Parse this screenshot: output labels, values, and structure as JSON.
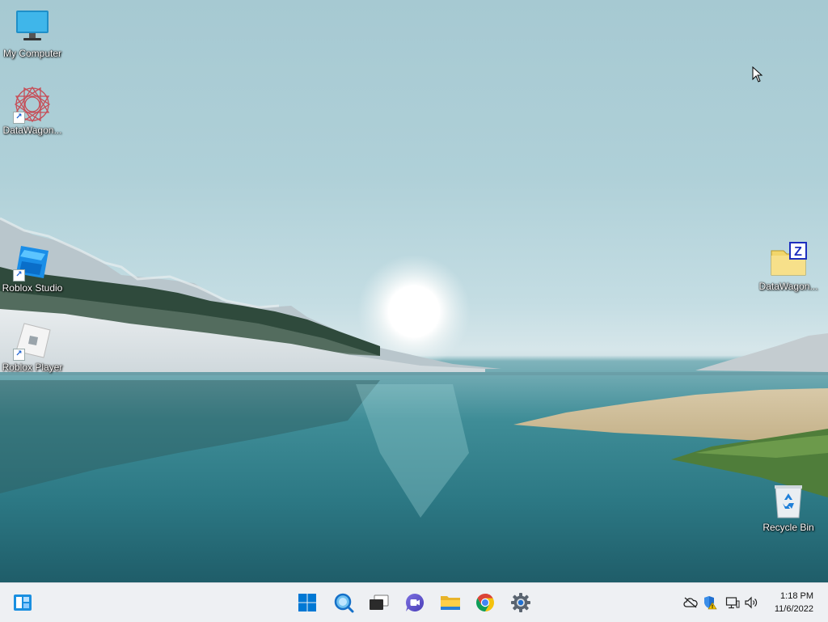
{
  "desktop": {
    "icons": [
      {
        "label": "My Computer",
        "icon": "computer-monitor-icon",
        "shortcut": false
      },
      {
        "label": "DataWagon...",
        "icon": "datawagon-spirograph-icon",
        "shortcut": true
      },
      {
        "label": "Roblox Studio",
        "icon": "roblox-studio-icon",
        "shortcut": true
      },
      {
        "label": "Roblox Player",
        "icon": "roblox-player-icon",
        "shortcut": true
      },
      {
        "label": "DataWagon...",
        "icon": "zip-folder-icon",
        "shortcut": false
      },
      {
        "label": "Recycle Bin",
        "icon": "recycle-bin-icon",
        "shortcut": false
      }
    ]
  },
  "taskbar": {
    "widgets_icon": "widgets-icon",
    "pinned": [
      {
        "name": "start",
        "icon": "windows-start-icon"
      },
      {
        "name": "search",
        "icon": "search-icon"
      },
      {
        "name": "task-view",
        "icon": "task-view-icon"
      },
      {
        "name": "chat",
        "icon": "teams-chat-icon"
      },
      {
        "name": "file-explorer",
        "icon": "folder-icon"
      },
      {
        "name": "chrome",
        "icon": "chrome-icon"
      },
      {
        "name": "settings",
        "icon": "gear-icon"
      }
    ],
    "tray": [
      "onedrive-offline-icon",
      "security-warning-icon",
      "network-icon",
      "volume-icon"
    ],
    "clock": {
      "time": "1:18 PM",
      "date": "11/6/2022"
    }
  },
  "colors": {
    "taskbar": "#eef0f3",
    "start_blue": "#0078d4"
  }
}
